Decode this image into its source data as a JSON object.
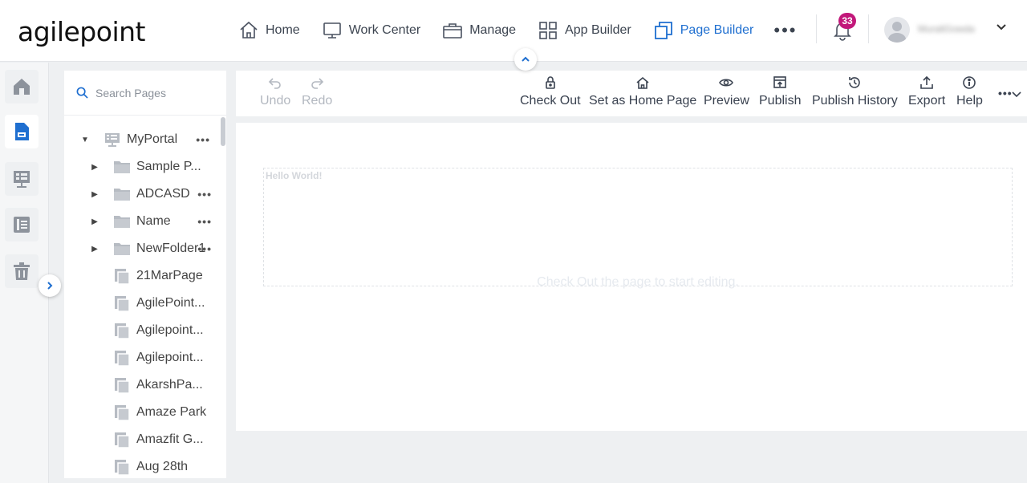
{
  "brand": {
    "logo_text": "agilepoint"
  },
  "nav": {
    "items": [
      {
        "label": "Home",
        "icon": "home-icon"
      },
      {
        "label": "Work Center",
        "icon": "monitor-icon"
      },
      {
        "label": "Manage",
        "icon": "briefcase-icon"
      },
      {
        "label": "App Builder",
        "icon": "grid-icon"
      },
      {
        "label": "Page Builder",
        "icon": "pages-icon",
        "active": true
      }
    ],
    "more_label": "•••"
  },
  "notifications": {
    "count": "33"
  },
  "user": {
    "name": "MuraliGowda"
  },
  "toolbar": {
    "undo": "Undo",
    "redo": "Redo",
    "check_out": "Check Out",
    "set_home": "Set as Home Page",
    "preview": "Preview",
    "publish": "Publish",
    "publish_history": "Publish History",
    "export": "Export",
    "help": "Help",
    "more": "•••"
  },
  "search": {
    "placeholder": "Search Pages"
  },
  "tree": {
    "root": {
      "label": "MyPortal",
      "more": "•••"
    },
    "folders": [
      {
        "label": "Sample P...",
        "more": ""
      },
      {
        "label": "ADCASD",
        "more": "•••"
      },
      {
        "label": "Name",
        "more": "•••"
      },
      {
        "label": "NewFolder1",
        "more": "•••"
      }
    ],
    "pages": [
      {
        "label": "21MarPage"
      },
      {
        "label": "AgilePoint..."
      },
      {
        "label": "Agilepoint..."
      },
      {
        "label": "Agilepoint..."
      },
      {
        "label": "AkarshPa..."
      },
      {
        "label": "Amaze Park"
      },
      {
        "label": "Amazfit G..."
      },
      {
        "label": "Aug 28th"
      }
    ]
  },
  "canvas": {
    "hello_text": "Hello World!",
    "hint_text": "Check Out the page to start editing."
  },
  "colors": {
    "accent": "#1f6fd0",
    "badge": "#c2187a"
  }
}
